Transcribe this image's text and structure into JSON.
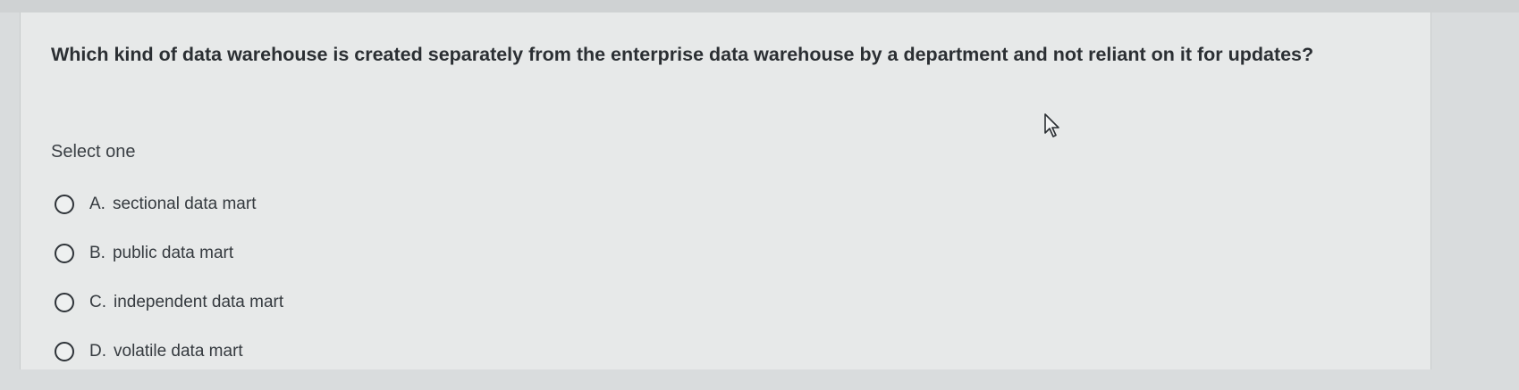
{
  "question": {
    "text": "Which kind of data warehouse is created separately from the enterprise data warehouse by a department and not reliant on it for updates?"
  },
  "prompt": {
    "select_one": "Select one"
  },
  "options": [
    {
      "letter": "A.",
      "text": "sectional data mart",
      "selected": false
    },
    {
      "letter": "B.",
      "text": "public data mart",
      "selected": false
    },
    {
      "letter": "C.",
      "text": "independent data mart",
      "selected": false
    },
    {
      "letter": "D.",
      "text": "volatile data mart",
      "selected": false
    }
  ],
  "icons": {
    "cursor": "mouse-pointer-icon"
  },
  "colors": {
    "page_background": "#d9dcdd",
    "card_background": "#e7e9e9",
    "text": "#2b2f33"
  }
}
